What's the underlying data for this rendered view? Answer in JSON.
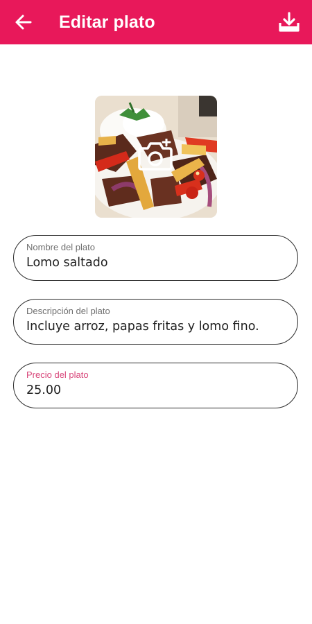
{
  "appbar": {
    "title": "Editar plato",
    "back_icon": "arrow-left-icon",
    "download_icon": "download-tray-icon",
    "color": "#e8185a"
  },
  "photo": {
    "overlay_icon": "camera-icon",
    "alt": "Lomo saltado"
  },
  "form": {
    "name": {
      "label": "Nombre del plato",
      "value": "Lomo saltado"
    },
    "description": {
      "label": "Descripción del plato",
      "value": "Incluye arroz, papas fritas y lomo fino."
    },
    "price": {
      "label": "Precio del plato",
      "value": "25.00",
      "label_color": "#d8467a"
    }
  }
}
